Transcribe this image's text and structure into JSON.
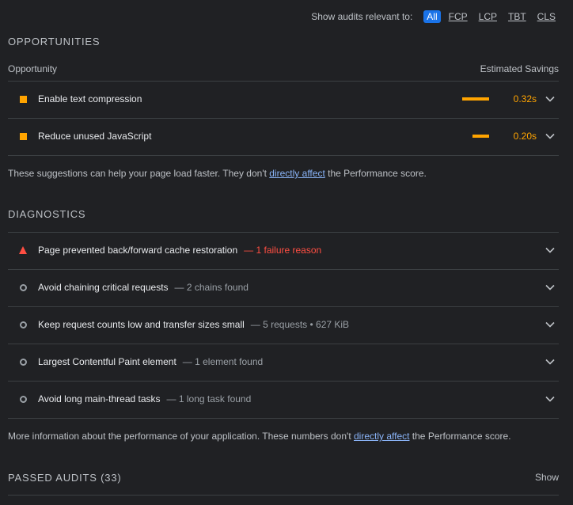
{
  "filter": {
    "label": "Show audits relevant to:",
    "chips": [
      "All",
      "FCP",
      "LCP",
      "TBT",
      "CLS"
    ]
  },
  "opportunities": {
    "title": "OPPORTUNITIES",
    "col_left": "Opportunity",
    "col_right": "Estimated Savings",
    "items": [
      {
        "title": "Enable text compression",
        "savings": "0.32s",
        "bar_fraction": 0.32
      },
      {
        "title": "Reduce unused JavaScript",
        "savings": "0.20s",
        "bar_fraction": 0.2
      }
    ],
    "note_before": "These suggestions can help your page load faster. They don't ",
    "note_link": "directly affect",
    "note_after": " the Performance score."
  },
  "diagnostics": {
    "title": "DIAGNOSTICS",
    "items": [
      {
        "title": "Page prevented back/forward cache restoration",
        "detail": "— 1 failure reason"
      },
      {
        "title": "Avoid chaining critical requests",
        "detail": "— 2 chains found"
      },
      {
        "title": "Keep request counts low and transfer sizes small",
        "detail": "— 5 requests • 627 KiB"
      },
      {
        "title": "Largest Contentful Paint element",
        "detail": "— 1 element found"
      },
      {
        "title": "Avoid long main-thread tasks",
        "detail": "— 1 long task found"
      }
    ],
    "note_before": "More information about the performance of your application. These numbers don't ",
    "note_link": "directly affect",
    "note_after": " the Performance score."
  },
  "passed": {
    "title": "PASSED AUDITS (33)",
    "show": "Show"
  },
  "colors": {
    "accent": "#1a73e8",
    "average": "#ffa400",
    "fail": "#ff4e42",
    "link": "#8ab4f8"
  }
}
